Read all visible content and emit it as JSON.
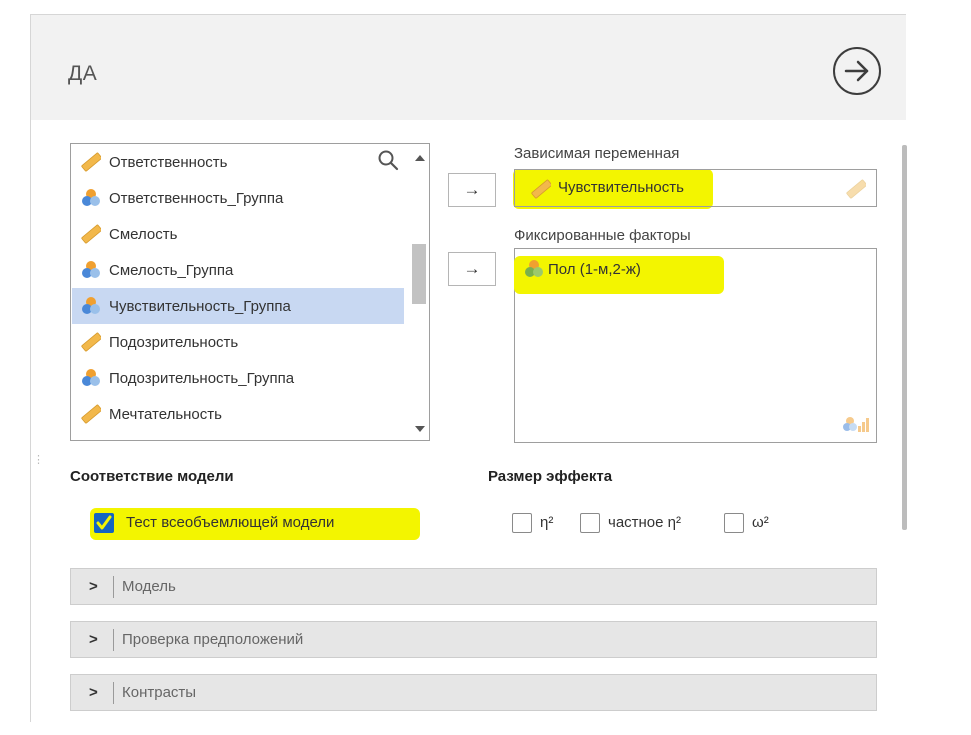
{
  "panel": {
    "title": "ДА"
  },
  "variables": [
    {
      "label": "Ответственность",
      "icon": "ruler-icon",
      "selected": false
    },
    {
      "label": "Ответственность_Группа",
      "icon": "nominal-icon",
      "selected": false
    },
    {
      "label": "Смелость",
      "icon": "ruler-icon",
      "selected": false
    },
    {
      "label": "Смелость_Группа",
      "icon": "nominal-icon",
      "selected": false
    },
    {
      "label": "Чувствительность_Группа",
      "icon": "nominal-icon",
      "selected": true
    },
    {
      "label": "Подозрительность",
      "icon": "ruler-icon",
      "selected": false
    },
    {
      "label": "Подозрительность_Группа",
      "icon": "nominal-icon",
      "selected": false
    },
    {
      "label": "Мечтательность",
      "icon": "ruler-icon",
      "selected": false
    }
  ],
  "dependent": {
    "label": "Зависимая переменная",
    "value": "Чувствительность"
  },
  "factors": {
    "label": "Фиксированные факторы",
    "items": [
      "Пол (1-м,2-ж)"
    ]
  },
  "arrow_glyph": "→",
  "model_fit": {
    "title": "Соответствие модели",
    "options": [
      {
        "label": "Тест всеобъемлющей модели",
        "checked": true
      }
    ]
  },
  "effect_size": {
    "title": "Размер эффекта",
    "options": [
      {
        "label": "η²",
        "checked": false
      },
      {
        "label": "частное η²",
        "checked": false
      },
      {
        "label": "ω²",
        "checked": false
      }
    ]
  },
  "sections": [
    {
      "label": "Модель"
    },
    {
      "label": "Проверка предположений"
    },
    {
      "label": "Контрасты"
    }
  ],
  "colors": {
    "highlight": "#f3f500",
    "selected_row": "#c8d8f2",
    "checkbox_fill": "#1565c0",
    "checkmark": "#f3f500"
  }
}
